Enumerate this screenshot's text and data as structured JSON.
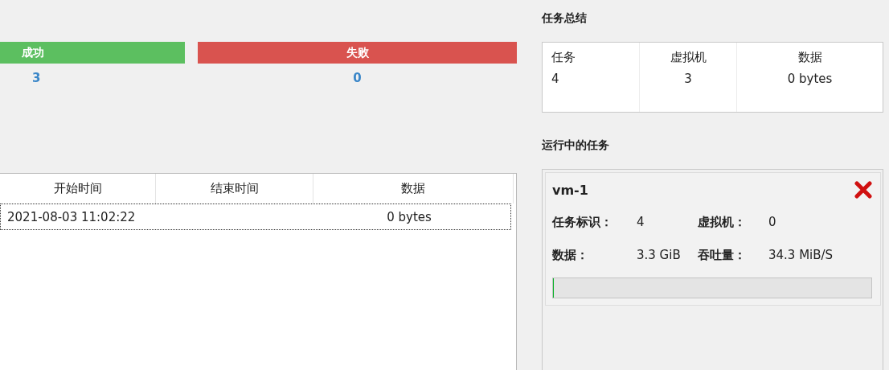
{
  "results": [
    {
      "kind": "success",
      "label": "成功",
      "count": "3"
    },
    {
      "kind": "failure",
      "label": "失败",
      "count": "0"
    }
  ],
  "jobs_table": {
    "columns": [
      "开始时间",
      "结束时间",
      "数据"
    ],
    "rows": [
      {
        "cells": [
          "2021-08-03 11:02:22",
          "",
          "0 bytes"
        ],
        "focused": true
      }
    ]
  },
  "summary": {
    "title": "任务总结",
    "columns": [
      {
        "label": "任务",
        "value": "4"
      },
      {
        "label": "虚拟机",
        "value": "3"
      },
      {
        "label": "数据",
        "value": "0 bytes"
      }
    ]
  },
  "running": {
    "title": "运行中的任务",
    "jobs": [
      {
        "name": "vm-1",
        "fields": [
          {
            "label": "任务标识：",
            "value": "4"
          },
          {
            "label": "虚拟机：",
            "value": "0"
          },
          {
            "label": "数据：",
            "value": "3.3 GiB"
          },
          {
            "label": "吞吐量：",
            "value": "34.3 MiB/S"
          }
        ],
        "level": 0
      }
    ]
  }
}
